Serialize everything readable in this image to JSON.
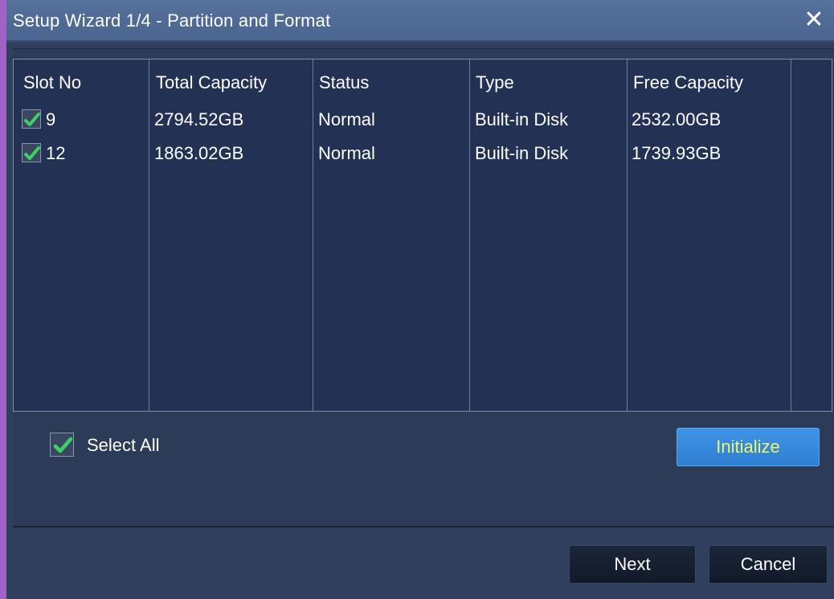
{
  "window": {
    "title": "Setup Wizard 1/4 - Partition and Format",
    "close_glyph": "✕"
  },
  "table": {
    "headers": [
      "Slot No",
      "Total Capacity",
      "Status",
      "Type",
      "Free Capacity"
    ],
    "rows": [
      {
        "checked": true,
        "slot": "9",
        "total": "2794.52GB",
        "status": "Normal",
        "type": "Built-in Disk",
        "free": "2532.00GB"
      },
      {
        "checked": true,
        "slot": "12",
        "total": "1863.02GB",
        "status": "Normal",
        "type": "Built-in Disk",
        "free": "1739.93GB"
      }
    ]
  },
  "select_all": {
    "label": "Select All",
    "checked": true
  },
  "buttons": {
    "initialize": "Initialize",
    "next": "Next",
    "cancel": "Cancel"
  },
  "colors": {
    "accent_purple": "#9f63c8",
    "title_bar": "#4e6a95",
    "check_green": "#3fd06a",
    "initialize_bg": "#3a8ae0",
    "initialize_text": "#eef56a"
  },
  "icons": {
    "close": "close-icon",
    "check": "checkmark-icon"
  }
}
